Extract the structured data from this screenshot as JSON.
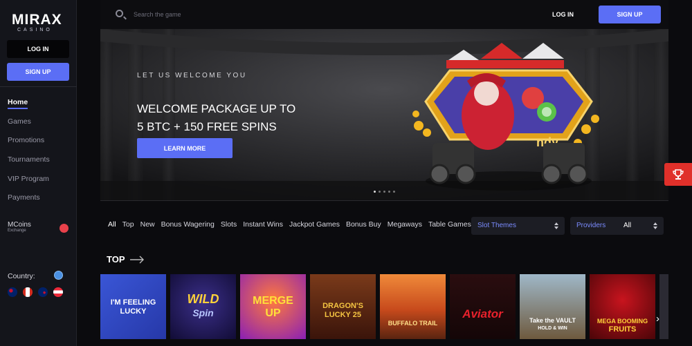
{
  "brand": {
    "name": "MIRAX",
    "sub": "CASINO"
  },
  "sidebar": {
    "login_label": "LOG IN",
    "signup_label": "SIGN UP",
    "nav": [
      "Home",
      "Games",
      "Promotions",
      "Tournaments",
      "VIP Program",
      "Payments"
    ],
    "active_index": 0,
    "mcoins_label": "MCoins",
    "mcoins_sub": "Exchange",
    "country_label": "Country:",
    "flags": [
      "australia-flag-icon",
      "canada-flag-icon",
      "new-zealand-flag-icon",
      "austria-flag-icon"
    ]
  },
  "header": {
    "search_placeholder": "Search the game",
    "login_label": "LOG IN",
    "signup_label": "SIGN UP"
  },
  "hero": {
    "tagline": "LET US WELCOME YOU",
    "title_line1": "WELCOME PACKAGE UP TO",
    "title_line2": "5 BTC + 150 FREE SPINS",
    "cta_label": "LEARN MORE",
    "slide_count": 5,
    "active_slide": 0
  },
  "filters": [
    "All",
    "Top",
    "New",
    "Bonus Wagering",
    "Slots",
    "Instant Wins",
    "Jackpot Games",
    "Bonus Buy",
    "Megaways",
    "Table Games"
  ],
  "selects": {
    "themes_label": "Slot Themes",
    "providers_label": "Providers",
    "providers_value": "All"
  },
  "section": {
    "title": "TOP"
  },
  "games": [
    {
      "title": "I'M FEELING LUCKY",
      "line1": "I'M FEELING",
      "line2": "LUCKY"
    },
    {
      "title": "Wild Spin",
      "line1": "WILD",
      "line2": "Spin"
    },
    {
      "title": "Merge Up",
      "line1": "MERGE",
      "line2": "UP"
    },
    {
      "title": "Dragon's Lucky 25",
      "line1": "DRAGON'S",
      "line2": "LUCKY 25"
    },
    {
      "title": "Buffalo Trail",
      "line1": "",
      "line2": "BUFFALO TRAIL"
    },
    {
      "title": "Aviator",
      "line1": "",
      "line2": "Aviator"
    },
    {
      "title": "Take the Vault Hold & Win",
      "line1": "Take the VAULT",
      "line2": "HOLD & WIN"
    },
    {
      "title": "Mega Booming Fruits",
      "line1": "MEGA BOOMING",
      "line2": "FRUITS"
    }
  ],
  "colors": {
    "accent": "#5b6ef5",
    "hot": "#e0302a",
    "link": "#7b8cff"
  }
}
